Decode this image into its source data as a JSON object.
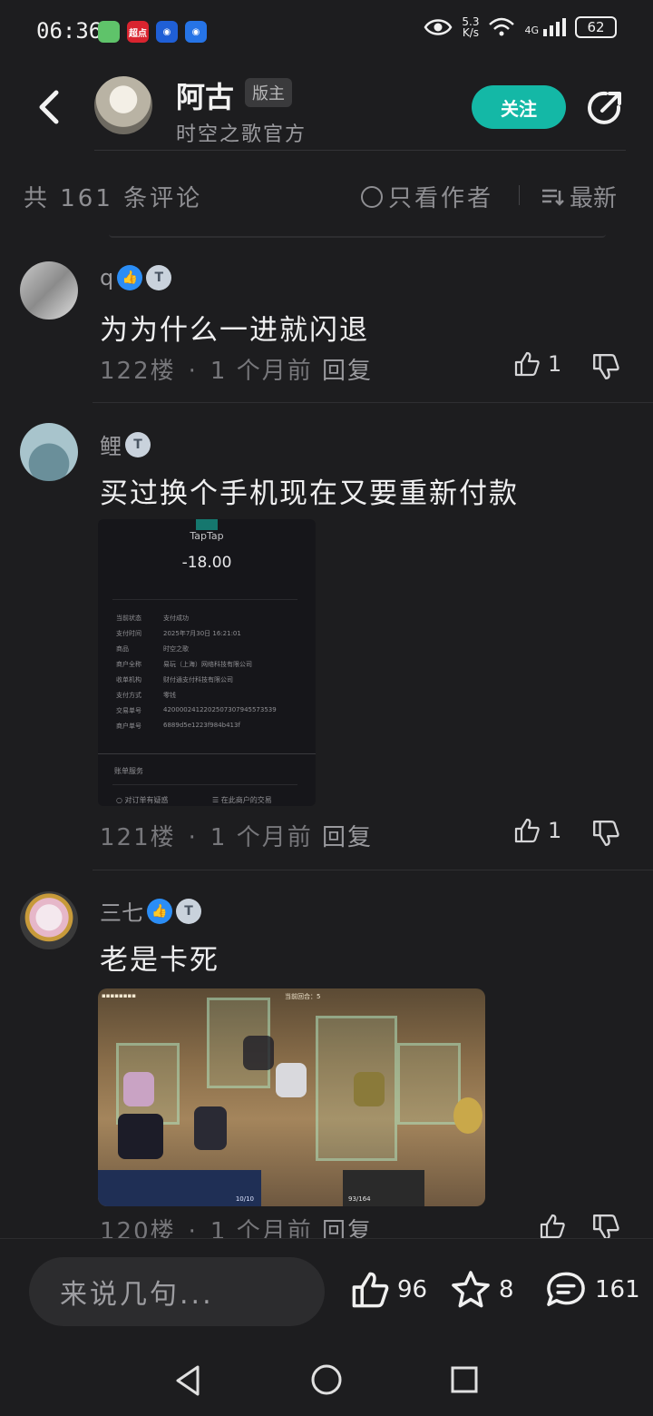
{
  "status_bar": {
    "time": "06:36",
    "app_icons": [
      {
        "name": "wechat-like-icon",
        "label": "",
        "color": "#5fc36a"
      },
      {
        "name": "chaodian-icon",
        "label": "超点",
        "color": "#d9242f"
      },
      {
        "name": "app-blue-icon",
        "label": "",
        "color": "#1f5fd6"
      },
      {
        "name": "app-blue2-icon",
        "label": "",
        "color": "#2674e6"
      }
    ],
    "net_speed_value": "5.3",
    "net_speed_unit": "K/s",
    "network": "4G",
    "battery": "62"
  },
  "header": {
    "name": "阿古",
    "role_badge": "版主",
    "subtitle": "时空之歌官方",
    "follow_label": "关注"
  },
  "filter_bar": {
    "count_text": "共 161 条评论",
    "only_author_label": "只看作者",
    "sort_label": "最新"
  },
  "comments": [
    {
      "username": "q",
      "badges": [
        "like",
        "T1"
      ],
      "text": "为为什么一进就闪退",
      "floor": "122楼",
      "time": "1 个月前",
      "reply_label": "回复",
      "likes": "1"
    },
    {
      "username": "鲤",
      "badges": [
        "T2"
      ],
      "text": "买过换个手机现在又要重新付款",
      "floor": "121楼",
      "time": "1 个月前",
      "reply_label": "回复",
      "likes": "1",
      "receipt": {
        "brand": "TapTap",
        "amount": "-18.00",
        "rows": [
          {
            "k": "当前状态",
            "v": "支付成功"
          },
          {
            "k": "支付时间",
            "v": "2025年7月30日 16:21:01"
          },
          {
            "k": "商品",
            "v": "时空之歌"
          },
          {
            "k": "商户全称",
            "v": "易玩（上海）网络科技有限公司"
          },
          {
            "k": "收单机构",
            "v": "财付通支付科技有限公司"
          },
          {
            "k": "支付方式",
            "v": "零钱"
          },
          {
            "k": "交易单号",
            "v": "4200002412202507307945573539"
          },
          {
            "k": "商户单号",
            "v": "6889d5e1223f984b413f"
          }
        ],
        "service_label": "账单服务",
        "link1": "对订单有疑惑",
        "link2": "在此商户的交易"
      }
    },
    {
      "username": "三七",
      "badges": [
        "like",
        "T1"
      ],
      "text": "老是卡死",
      "floor": "120楼",
      "time": "1 个月前",
      "reply_label": "回复",
      "likes": "",
      "game_image": {
        "round_text": "当前回合：5",
        "hud_left": "10/10",
        "hud_right": "93/164"
      }
    }
  ],
  "bottom_bar": {
    "input_placeholder": "来说几句...",
    "likes": "96",
    "favorites": "8",
    "comments": "161"
  },
  "colors": {
    "accent": "#14b8a6",
    "background": "#1d1d1f",
    "like_badge": "#2b8df5"
  }
}
